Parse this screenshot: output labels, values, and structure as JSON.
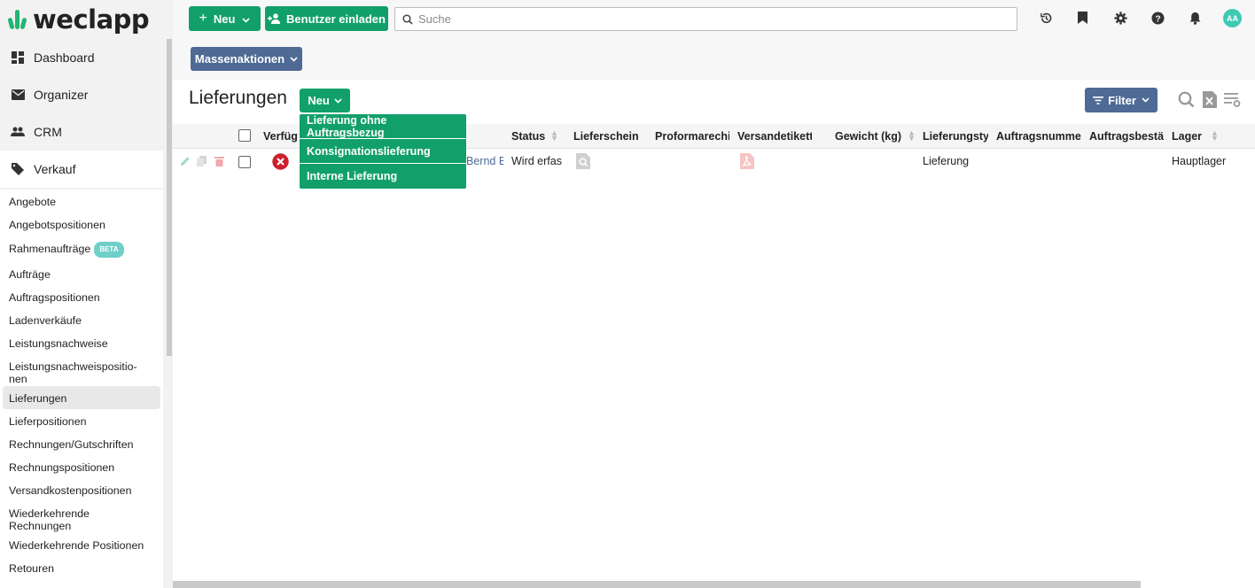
{
  "brand": {
    "name": "weclapp",
    "color": "#22b573"
  },
  "sidebar": {
    "main_items": [
      {
        "label": "Dashboard",
        "icon": "dashboard-icon"
      },
      {
        "label": "Organizer",
        "icon": "envelope-icon"
      },
      {
        "label": "CRM",
        "icon": "people-icon"
      },
      {
        "label": "Verkauf",
        "icon": "tag-icon",
        "active": true
      }
    ],
    "sub_items": [
      "Angebote",
      "Angebotspositionen",
      "Rahmenaufträge",
      "Aufträge",
      "Auftragspositionen",
      "Ladenverkäufe",
      "Leistungsnachweise",
      "Leistungsnachweispositio-",
      "nen",
      "Lieferungen",
      "Lieferpositionen",
      "Rechnungen/Gutschriften",
      "Rechnungspositionen",
      "Versandkostenpositionen",
      "Wiederkehrende",
      "Rechnungen",
      "Wiederkehrende Positionen",
      "Retouren"
    ],
    "beta_label": "BETA"
  },
  "topbar": {
    "new_label": "Neu",
    "invite_label": "Benutzer einladen",
    "search_placeholder": "Suche",
    "avatar_initials": "AA"
  },
  "toolbar": {
    "mass_actions_label": "Massenaktionen"
  },
  "page": {
    "title": "Lieferungen",
    "new_label": "Neu",
    "filter_label": "Filter",
    "new_menu": [
      "Lieferung ohne Auftragsbezug",
      "Konsignationslieferung",
      "Interne Lieferung"
    ]
  },
  "table": {
    "columns": [
      "Verfüg",
      "Status",
      "Lieferschein",
      "Proformarechi",
      "Versandetikett",
      "Gewicht (kg)",
      "Lieferungsty",
      "Auftragsnumme",
      "Auftragsbestä",
      "Lager"
    ],
    "row": {
      "customer": "Bernd B",
      "status": "Wird erfas",
      "type": "Lieferung",
      "warehouse": "Hauptlager"
    }
  },
  "colors": {
    "green": "#12a06a",
    "blue": "#4e6a95",
    "error": "#cc1f2d"
  }
}
